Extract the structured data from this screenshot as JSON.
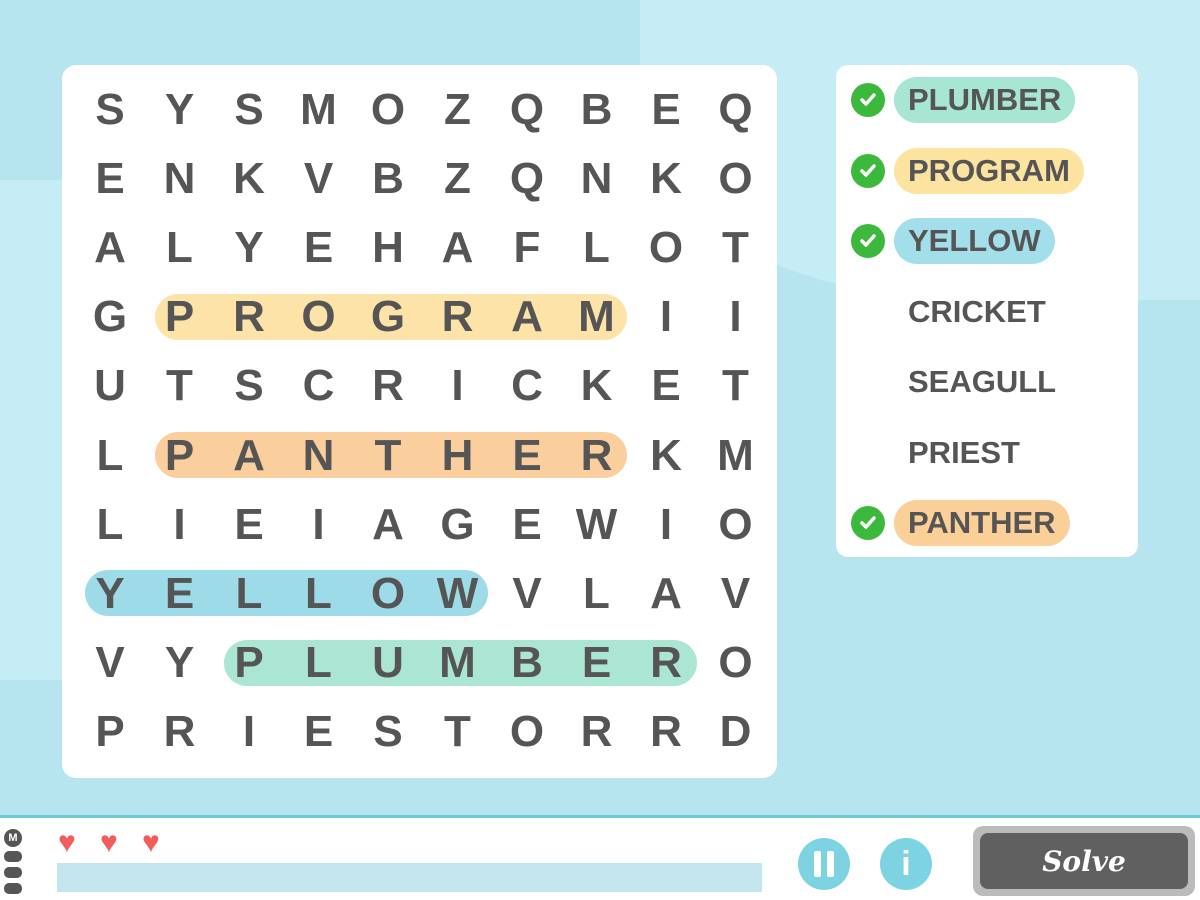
{
  "grid": [
    [
      "S",
      "Y",
      "S",
      "M",
      "O",
      "Z",
      "Q",
      "B",
      "E",
      "Q"
    ],
    [
      "E",
      "N",
      "K",
      "V",
      "B",
      "Z",
      "Q",
      "N",
      "K",
      "O"
    ],
    [
      "A",
      "L",
      "Y",
      "E",
      "H",
      "A",
      "F",
      "L",
      "O",
      "T"
    ],
    [
      "G",
      "P",
      "R",
      "O",
      "G",
      "R",
      "A",
      "M",
      "I",
      "I"
    ],
    [
      "U",
      "T",
      "S",
      "C",
      "R",
      "I",
      "C",
      "K",
      "E",
      "T"
    ],
    [
      "L",
      "P",
      "A",
      "N",
      "T",
      "H",
      "E",
      "R",
      "K",
      "M"
    ],
    [
      "L",
      "I",
      "E",
      "I",
      "A",
      "G",
      "E",
      "W",
      "I",
      "O"
    ],
    [
      "Y",
      "E",
      "L",
      "L",
      "O",
      "W",
      "V",
      "L",
      "A",
      "V"
    ],
    [
      "V",
      "Y",
      "P",
      "L",
      "U",
      "M",
      "B",
      "E",
      "R",
      "O"
    ],
    [
      "P",
      "R",
      "I",
      "E",
      "S",
      "T",
      "O",
      "R",
      "R",
      "D"
    ]
  ],
  "found_highlights": [
    {
      "word": "PROGRAM",
      "row": 3,
      "col_start": 1,
      "col_end": 7,
      "color": "#fcd98a"
    },
    {
      "word": "PANTHER",
      "row": 5,
      "col_start": 1,
      "col_end": 7,
      "color": "#f8bd7c"
    },
    {
      "word": "YELLOW",
      "row": 7,
      "col_start": 0,
      "col_end": 5,
      "color": "#7ecfe0"
    },
    {
      "word": "PLUMBER",
      "row": 8,
      "col_start": 2,
      "col_end": 8,
      "color": "#8fdcc4"
    }
  ],
  "words": [
    {
      "label": "PLUMBER",
      "found": true,
      "color": "#a6e6d2"
    },
    {
      "label": "PROGRAM",
      "found": true,
      "color": "#fde3a0"
    },
    {
      "label": "YELLOW",
      "found": true,
      "color": "#a2dfeb"
    },
    {
      "label": "CRICKET",
      "found": false
    },
    {
      "label": "SEAGULL",
      "found": false
    },
    {
      "label": "PRIEST",
      "found": false
    },
    {
      "label": "PANTHER",
      "found": true,
      "color": "#fbcf98"
    }
  ],
  "lives": 3,
  "progress_percent": 0,
  "menu_label": "M",
  "solve_label": "Solve",
  "info_label": "i"
}
